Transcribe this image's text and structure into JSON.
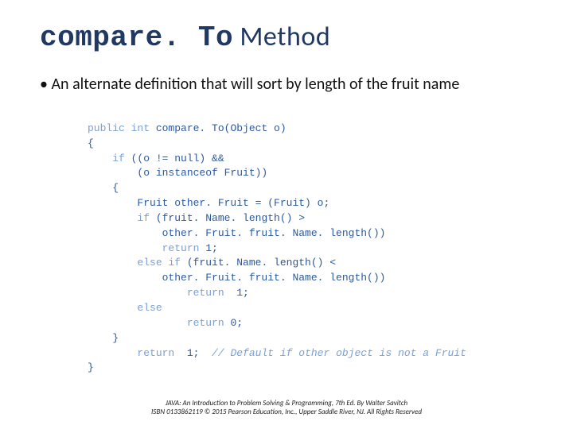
{
  "title_mono": "compare. To",
  "title_word": " Method",
  "bullet": "• An alternate definition that will sort by length of the fruit name",
  "code": {
    "sig_light": "public int ",
    "sig_rest": "compare. To(Object o)",
    "l_open1": "{",
    "l_if1a": "    if ",
    "l_if1b": "((o != null) &&",
    "l_if2": "        (o instanceof Fruit))",
    "l_open2": "    {",
    "l_cast": "        Fruit other. Fruit = (Fruit) o;",
    "l_if3a": "        if ",
    "l_if3b": "(fruit. Name. length() >",
    "l_if3c": "            other. Fruit. fruit. Name. length())",
    "l_ret1a": "            return ",
    "l_ret1b": "1;",
    "l_elifA": "        else if ",
    "l_elifB": "(fruit. Name. length() <",
    "l_elifC": "            other. Fruit. fruit. Name. length())",
    "l_ret2a": "                return  ",
    "l_ret2b": "1;",
    "l_else": "        else",
    "l_ret3a": "                return ",
    "l_ret3b": "0;",
    "l_close2": "    }",
    "l_ret4a": "        return  ",
    "l_ret4b": "1;  ",
    "l_ret4c": "// Default if other object is not a Fruit",
    "l_close1": "}"
  },
  "footer1": "JAVA: An Introduction to Problem Solving & Programming, 7th Ed. By Walter Savitch",
  "footer2": "ISBN 0133862119 © 2015 Pearson Education, Inc., Upper Saddle River, NJ. All Rights Reserved"
}
